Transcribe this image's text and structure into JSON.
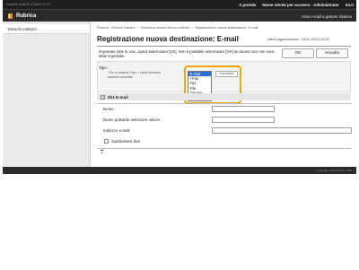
{
  "header": {
    "product_name": "imageRUNNER ADVANCE DX",
    "to_portal": "A portale",
    "login_label": "Nome utente per accesso :",
    "login_user": "Administrator",
    "logout": "Esci"
  },
  "titlebar": {
    "title": "Rubrica",
    "system_manager_link": "Invio e-mail a gestore sistema"
  },
  "sidebar": {
    "items": [
      {
        "label": "Elenchi indirizzi"
      }
    ]
  },
  "main": {
    "breadcrumb": [
      "Rubrica : Elenchi indirizzi",
      "Selezione veloce elenco indirizzi",
      "Registrazione nuova destinazione: E-mail"
    ],
    "page_title": "Registrazione nuova destinazione: E-mail",
    "last_updated": "Ultimo aggiornamento : 04/11 2020 2:20:51",
    "ok_label": "OK",
    "cancel_label": "Annulla",
    "message": "Impostare tutte le voci, quindi selezionare [OK]. Non è possibile selezionare [OK] se alcune voci non sono state impostate.",
    "type_label": "Tipo :",
    "type_note": "*Se si cambia il tipo, i valori immessi saranno annullati.",
    "type_options": [
      "E-mail",
      "I-Fax",
      "Fax",
      "File",
      "Gruppo"
    ],
    "type_selected_index": 0,
    "set_button": "Impostato",
    "section_title": "001 E-mail",
    "fields": {
      "name_label": "Nome :",
      "speed_label": "Nome pulsante selezione veloce :",
      "email_label": "Indirizzo e-mail",
      "divide_label": "Suddivisione dati"
    },
    "collapse_icon": "double-chevron-up-icon"
  },
  "footer": {
    "copyright": "Copyright CANON INC. 2020"
  }
}
